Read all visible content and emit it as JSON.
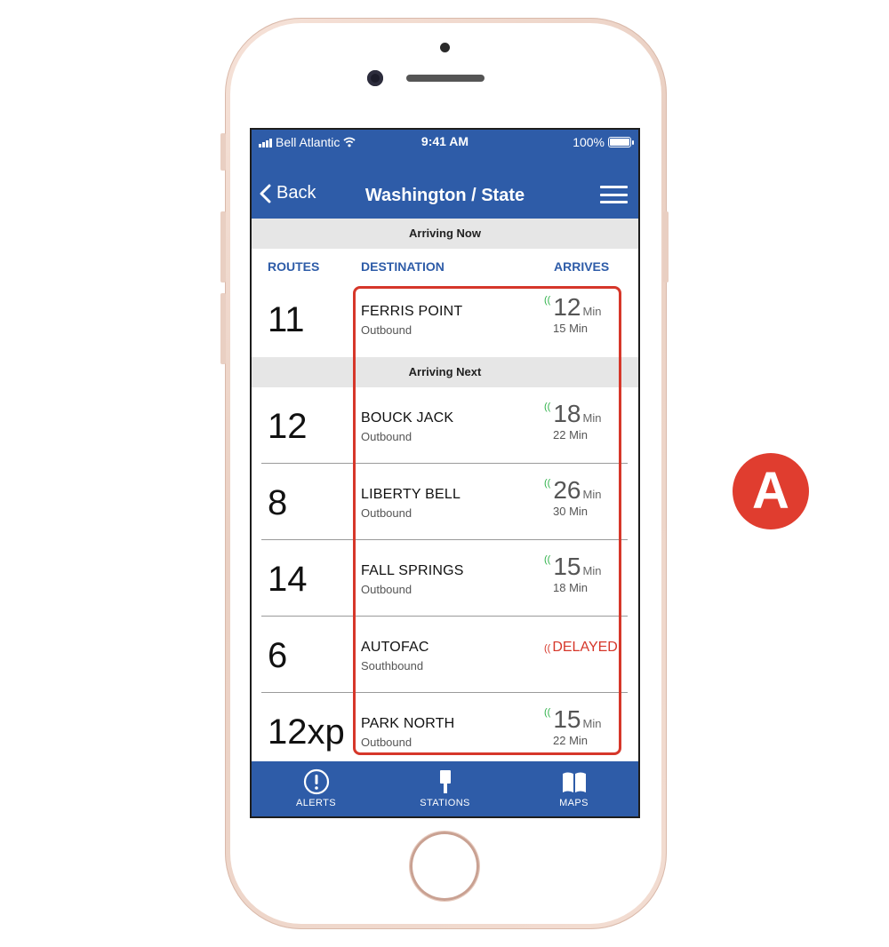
{
  "status_bar": {
    "carrier": "Bell Atlantic",
    "time": "9:41 AM",
    "battery": "100%"
  },
  "nav": {
    "back_label": "Back",
    "title": "Washington / State"
  },
  "sections": {
    "now": "Arriving Now",
    "next": "Arriving Next"
  },
  "columns": {
    "routes": "ROUTES",
    "destination": "DESTINATION",
    "arrives": "ARRIVES"
  },
  "arrivals": [
    {
      "route": "11",
      "destination": "FERRIS POINT",
      "direction": "Outbound",
      "minutes": "12",
      "unit": "Min",
      "next": "15 Min",
      "status": "on_time"
    },
    {
      "route": "12",
      "destination": "BOUCK JACK",
      "direction": "Outbound",
      "minutes": "18",
      "unit": "Min",
      "next": "22 Min",
      "status": "on_time"
    },
    {
      "route": "8",
      "destination": "LIBERTY BELL",
      "direction": "Outbound",
      "minutes": "26",
      "unit": "Min",
      "next": "30 Min",
      "status": "on_time"
    },
    {
      "route": "14",
      "destination": "FALL SPRINGS",
      "direction": "Outbound",
      "minutes": "15",
      "unit": "Min",
      "next": "18 Min",
      "status": "on_time"
    },
    {
      "route": "6",
      "destination": "AUTOFAC",
      "direction": "Southbound",
      "delayed_label": "DELAYED",
      "status": "delayed"
    },
    {
      "route": "12xp",
      "destination": "PARK NORTH",
      "direction": "Outbound",
      "minutes": "15",
      "unit": "Min",
      "next": "22 Min",
      "status": "on_time"
    }
  ],
  "signal_glyph": "((",
  "tabs": [
    {
      "label": "ALERTS",
      "icon": "alert-icon"
    },
    {
      "label": "STATIONS",
      "icon": "station-icon"
    },
    {
      "label": "MAPS",
      "icon": "map-book-icon"
    }
  ],
  "badge": "A",
  "colors": {
    "brand_blue": "#2e5ca8",
    "highlight_red": "#d6372a",
    "live_green": "#2fb24a",
    "section_gray": "#e6e6e6"
  }
}
